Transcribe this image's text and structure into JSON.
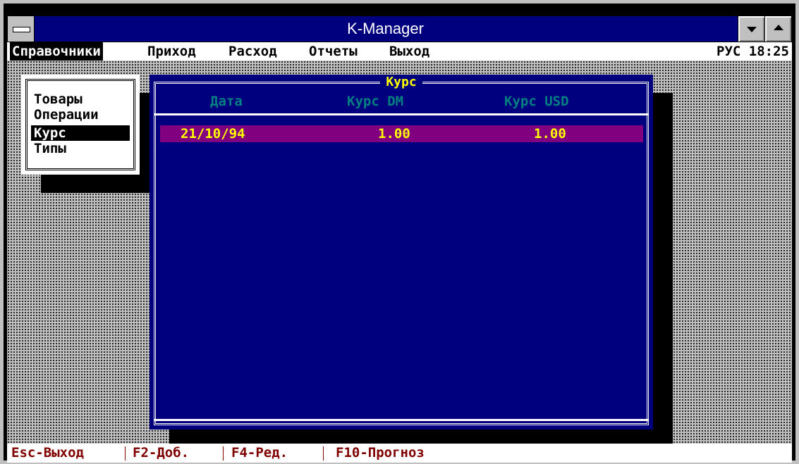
{
  "window": {
    "title": "K-Manager"
  },
  "menubar": {
    "items": [
      "Справочники",
      "Приход",
      "Расход",
      "Отчеты",
      "Выход"
    ],
    "status": "РУС 18:25"
  },
  "submenu": {
    "items": [
      "Товары",
      "Операции",
      "Курс",
      "Типы"
    ]
  },
  "dialog": {
    "title": "Курс",
    "columns": [
      "Дата",
      "Курс DM",
      "Курс USD"
    ],
    "rows": [
      [
        "21/10/94",
        "1.00",
        "1.00"
      ]
    ]
  },
  "statusbar": {
    "items": [
      "Esc-Выход",
      "F2-Доб.",
      "F4-Ред.",
      "F10-Прогноз"
    ]
  },
  "colors": {
    "title_bar": "#00007f",
    "dialog_bg": "#00007f",
    "selected_row": "#800080",
    "accent_text": "#ffff00",
    "header_text": "#008080",
    "status_text": "#800000"
  }
}
